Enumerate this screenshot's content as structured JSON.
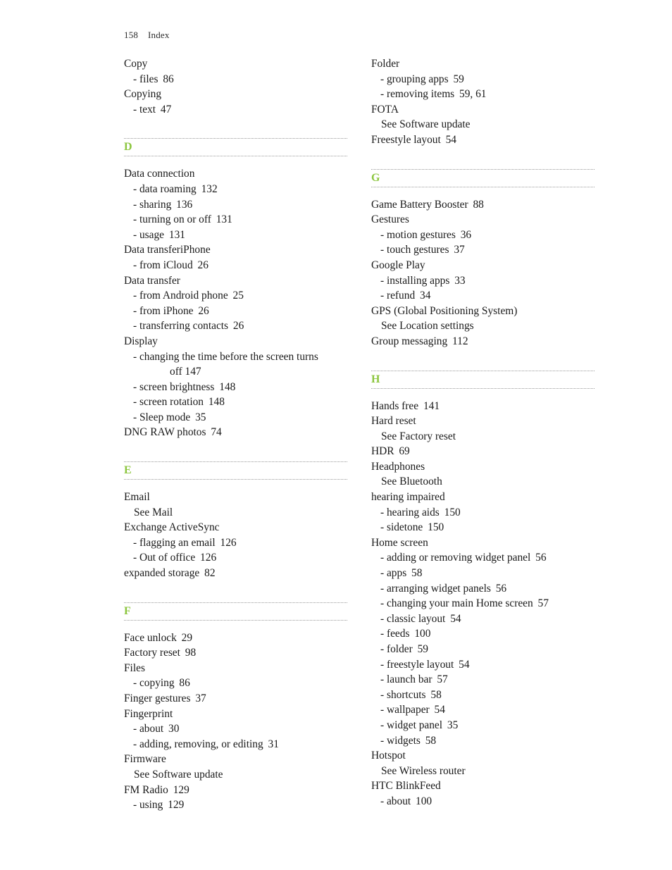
{
  "page": {
    "folio": "158",
    "section_label": "Index",
    "accent_color": "#8cc63f",
    "rule_color": "#9a9a9a",
    "text_color": "#1a1a1a"
  },
  "columns": [
    {
      "name": "left-column",
      "blocks": [
        {
          "type": "entries",
          "entries": [
            {
              "level": 0,
              "text": "Copy"
            },
            {
              "level": 1,
              "text": "- files",
              "page": "86"
            },
            {
              "level": 0,
              "text": "Copying"
            },
            {
              "level": 1,
              "text": "- text",
              "page": "47"
            }
          ]
        },
        {
          "type": "letter",
          "letter": "D"
        },
        {
          "type": "entries",
          "entries": [
            {
              "level": 0,
              "text": "Data connection"
            },
            {
              "level": 1,
              "text": "- data roaming",
              "page": "132"
            },
            {
              "level": 1,
              "text": "- sharing",
              "page": "136"
            },
            {
              "level": 1,
              "text": "- turning on or off",
              "page": "131"
            },
            {
              "level": 1,
              "text": "- usage",
              "page": "131"
            },
            {
              "level": 0,
              "text": "Data transferiPhone"
            },
            {
              "level": 1,
              "text": "- from iCloud",
              "page": "26"
            },
            {
              "level": 0,
              "text": "Data transfer"
            },
            {
              "level": 1,
              "text": "- from Android phone",
              "page": "25"
            },
            {
              "level": 1,
              "text": "- from iPhone",
              "page": "26"
            },
            {
              "level": 1,
              "text": "- transferring contacts",
              "page": "26"
            },
            {
              "level": 0,
              "text": "Display"
            },
            {
              "level": 1,
              "wrap": true,
              "text": "- changing the time before the screen turns",
              "cont": "off  147"
            },
            {
              "level": 1,
              "text": "- screen brightness",
              "page": "148"
            },
            {
              "level": 1,
              "text": "- screen rotation",
              "page": "148"
            },
            {
              "level": 1,
              "text": "- Sleep mode",
              "page": "35"
            },
            {
              "level": 0,
              "text": "DNG RAW photos",
              "page": "74"
            }
          ]
        },
        {
          "type": "letter",
          "letter": "E"
        },
        {
          "type": "entries",
          "entries": [
            {
              "level": 0,
              "text": "Email"
            },
            {
              "level": 0,
              "see": true,
              "text": "See Mail"
            },
            {
              "level": 0,
              "text": "Exchange ActiveSync"
            },
            {
              "level": 1,
              "text": "- flagging an email",
              "page": "126"
            },
            {
              "level": 1,
              "text": "- Out of office",
              "page": "126"
            },
            {
              "level": 0,
              "text": "expanded storage",
              "page": "82"
            }
          ]
        },
        {
          "type": "letter",
          "letter": "F"
        },
        {
          "type": "entries",
          "entries": [
            {
              "level": 0,
              "text": "Face unlock",
              "page": "29"
            },
            {
              "level": 0,
              "text": "Factory reset",
              "page": "98"
            },
            {
              "level": 0,
              "text": "Files"
            },
            {
              "level": 1,
              "text": "- copying",
              "page": "86"
            },
            {
              "level": 0,
              "text": "Finger gestures",
              "page": "37"
            },
            {
              "level": 0,
              "text": "Fingerprint"
            },
            {
              "level": 1,
              "text": "- about",
              "page": "30"
            },
            {
              "level": 1,
              "text": "- adding, removing, or editing",
              "page": "31"
            },
            {
              "level": 0,
              "text": "Firmware"
            },
            {
              "level": 0,
              "see": true,
              "text": "See Software update"
            },
            {
              "level": 0,
              "text": "FM Radio",
              "page": "129"
            },
            {
              "level": 1,
              "text": "- using",
              "page": "129"
            }
          ]
        }
      ]
    },
    {
      "name": "right-column",
      "blocks": [
        {
          "type": "entries",
          "entries": [
            {
              "level": 0,
              "text": "Folder"
            },
            {
              "level": 1,
              "text": "- grouping apps",
              "page": "59"
            },
            {
              "level": 1,
              "text": "- removing items",
              "page": "59, 61"
            },
            {
              "level": 0,
              "text": "FOTA"
            },
            {
              "level": 0,
              "see": true,
              "text": "See Software update"
            },
            {
              "level": 0,
              "text": "Freestyle layout",
              "page": "54"
            }
          ]
        },
        {
          "type": "letter",
          "letter": "G"
        },
        {
          "type": "entries",
          "entries": [
            {
              "level": 0,
              "text": "Game Battery Booster",
              "page": "88"
            },
            {
              "level": 0,
              "text": "Gestures"
            },
            {
              "level": 1,
              "text": "- motion gestures",
              "page": "36"
            },
            {
              "level": 1,
              "text": "- touch gestures",
              "page": "37"
            },
            {
              "level": 0,
              "text": "Google Play"
            },
            {
              "level": 1,
              "text": "- installing apps",
              "page": "33"
            },
            {
              "level": 1,
              "text": "- refund",
              "page": "34"
            },
            {
              "level": 0,
              "text": "GPS (Global Positioning System)"
            },
            {
              "level": 0,
              "see": true,
              "text": "See Location settings"
            },
            {
              "level": 0,
              "text": "Group messaging",
              "page": "112"
            }
          ]
        },
        {
          "type": "letter",
          "letter": "H"
        },
        {
          "type": "entries",
          "entries": [
            {
              "level": 0,
              "text": "Hands free",
              "page": "141"
            },
            {
              "level": 0,
              "text": "Hard reset"
            },
            {
              "level": 0,
              "see": true,
              "text": "See Factory reset"
            },
            {
              "level": 0,
              "text": "HDR",
              "page": "69"
            },
            {
              "level": 0,
              "text": "Headphones"
            },
            {
              "level": 0,
              "see": true,
              "text": "See Bluetooth"
            },
            {
              "level": 0,
              "text": "hearing impaired"
            },
            {
              "level": 1,
              "text": "- hearing aids",
              "page": "150"
            },
            {
              "level": 1,
              "text": "- sidetone",
              "page": "150"
            },
            {
              "level": 0,
              "text": "Home screen"
            },
            {
              "level": 1,
              "text": "- adding or removing widget panel",
              "page": "56"
            },
            {
              "level": 1,
              "text": "- apps",
              "page": "58"
            },
            {
              "level": 1,
              "text": "- arranging widget panels",
              "page": "56"
            },
            {
              "level": 1,
              "text": "- changing your main Home screen",
              "page": "57"
            },
            {
              "level": 1,
              "text": "- classic layout",
              "page": "54"
            },
            {
              "level": 1,
              "text": "- feeds",
              "page": "100"
            },
            {
              "level": 1,
              "text": "- folder",
              "page": "59"
            },
            {
              "level": 1,
              "text": "- freestyle layout",
              "page": "54"
            },
            {
              "level": 1,
              "text": "- launch bar",
              "page": "57"
            },
            {
              "level": 1,
              "text": "- shortcuts",
              "page": "58"
            },
            {
              "level": 1,
              "text": "- wallpaper",
              "page": "54"
            },
            {
              "level": 1,
              "text": "- widget panel",
              "page": "35"
            },
            {
              "level": 1,
              "text": "- widgets",
              "page": "58"
            },
            {
              "level": 0,
              "text": "Hotspot"
            },
            {
              "level": 0,
              "see": true,
              "text": "See Wireless router"
            },
            {
              "level": 0,
              "text": "HTC BlinkFeed"
            },
            {
              "level": 1,
              "text": "- about",
              "page": "100"
            }
          ]
        }
      ]
    }
  ]
}
